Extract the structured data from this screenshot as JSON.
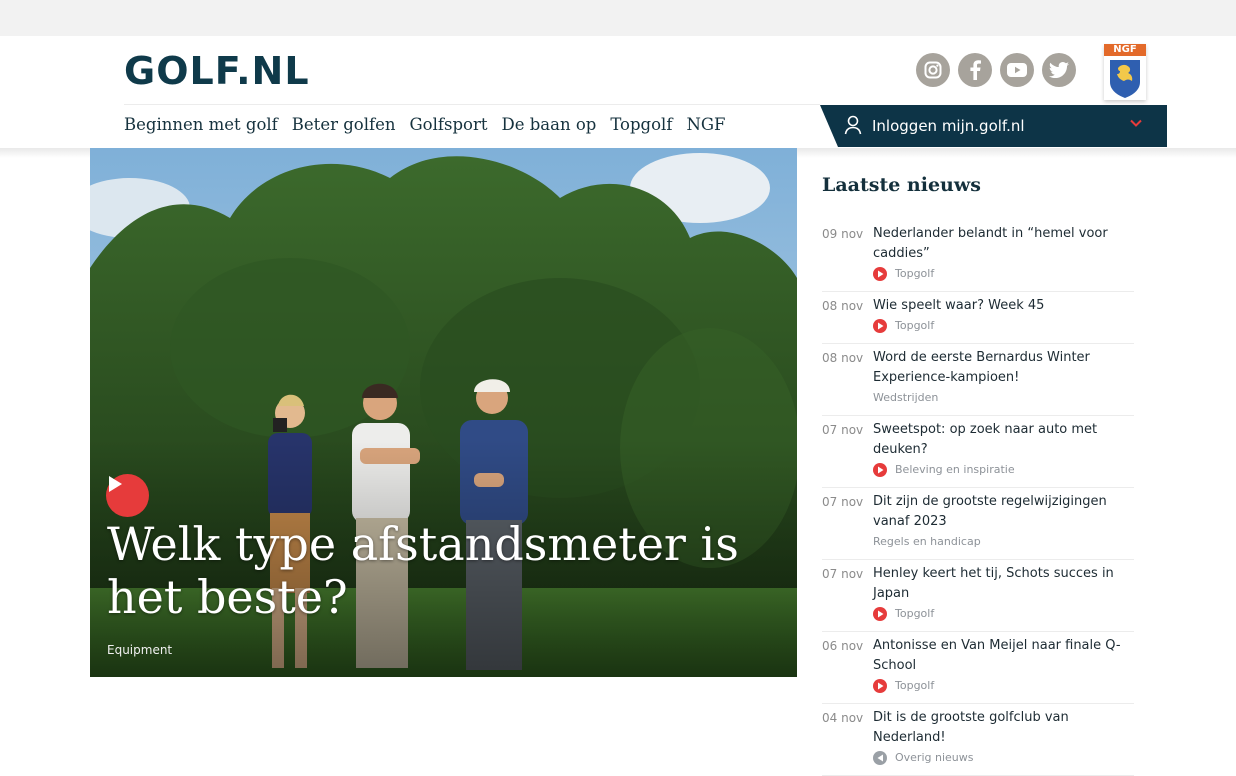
{
  "brand": {
    "logo_text": "GOLF.NL",
    "color": "#0f3a4a"
  },
  "social": [
    "instagram-icon",
    "facebook-icon",
    "youtube-icon",
    "twitter-icon"
  ],
  "ngf_badge": {
    "label": "NGF"
  },
  "nav": {
    "items": [
      {
        "label": "Beginnen met golf"
      },
      {
        "label": "Beter golfen"
      },
      {
        "label": "Golfsport"
      },
      {
        "label": "De baan op"
      },
      {
        "label": "Topgolf"
      },
      {
        "label": "NGF"
      }
    ]
  },
  "login": {
    "label": "Inloggen mijn.golf.nl",
    "bg": "#0d3447"
  },
  "hero": {
    "title": "Welk type afstandsmeter is het beste?",
    "category": "Equipment",
    "accent": "#e63b3b"
  },
  "news": {
    "heading": "Laatste nieuws",
    "items": [
      {
        "date": "09 nov",
        "title": "Nederlander belandt in “hemel voor caddies”",
        "category": "Topgolf",
        "icon": "play"
      },
      {
        "date": "08 nov",
        "title": "Wie speelt waar? Week 45",
        "category": "Topgolf",
        "icon": "play"
      },
      {
        "date": "08 nov",
        "title": "Word de eerste Bernardus Winter Experience-kampioen!",
        "category": "Wedstrijden",
        "icon": "none"
      },
      {
        "date": "07 nov",
        "title": "Sweetspot: op zoek naar auto met deuken?",
        "category": "Beleving en inspiratie",
        "icon": "play"
      },
      {
        "date": "07 nov",
        "title": "Dit zijn de grootste regelwijzigingen vanaf 2023",
        "category": "Regels en handicap",
        "icon": "none"
      },
      {
        "date": "07 nov",
        "title": "Henley keert het tij, Schots succes in Japan",
        "category": "Topgolf",
        "icon": "play"
      },
      {
        "date": "06 nov",
        "title": "Antonisse en Van Meijel naar finale Q-School",
        "category": "Topgolf",
        "icon": "play"
      },
      {
        "date": "04 nov",
        "title": "Dit is de grootste golfclub van Nederland!",
        "category": "Overig nieuws",
        "icon": "back"
      }
    ]
  }
}
